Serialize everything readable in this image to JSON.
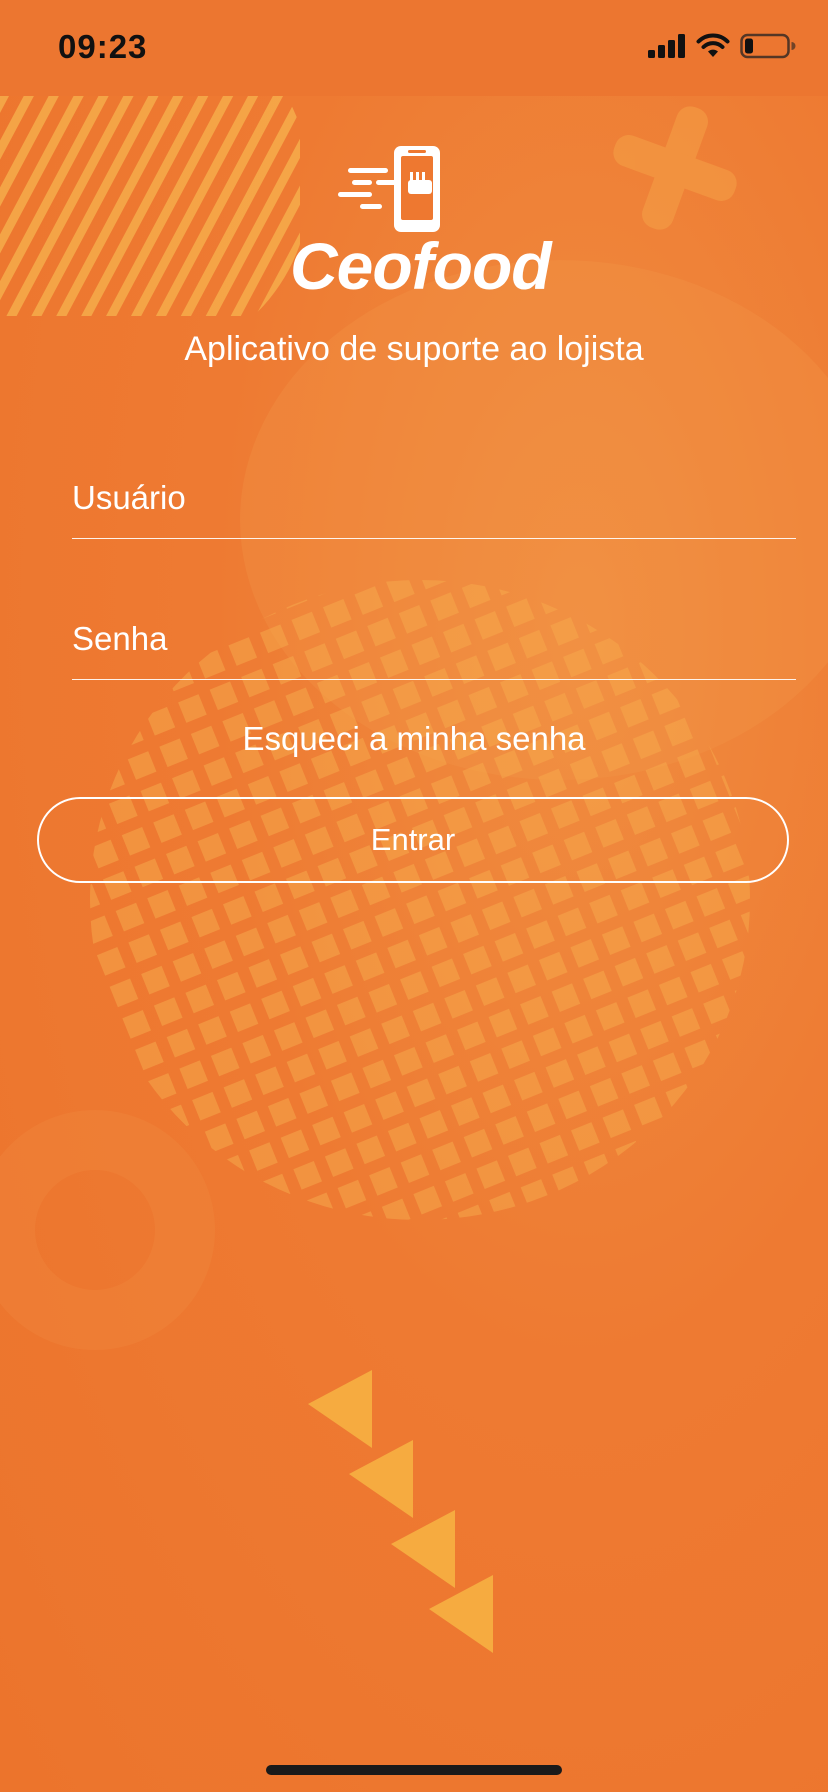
{
  "status_bar": {
    "time": "09:23",
    "signal_icon": "cellular-signal-icon",
    "wifi_icon": "wifi-icon",
    "battery_icon": "battery-low-icon"
  },
  "brand": {
    "name": "Ceofood",
    "logo_icon": "phone-delivery-fork-icon"
  },
  "subtitle": "Aplicativo de suporte ao lojista",
  "form": {
    "username_placeholder": "Usuário",
    "password_placeholder": "Senha",
    "forgot_label": "Esqueci a minha senha",
    "submit_label": "Entrar"
  },
  "colors": {
    "background": "#ee7830",
    "accent_deco": "#f5b042",
    "text": "#ffffff"
  }
}
